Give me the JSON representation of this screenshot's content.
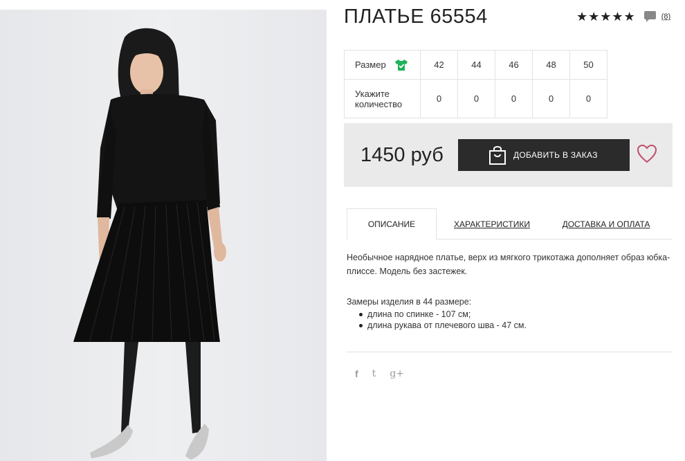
{
  "product": {
    "title": "ПЛАТЬЕ 65554",
    "stars": "★★★★★",
    "review_count": "(8)"
  },
  "size_table": {
    "size_label": "Размер",
    "qty_label_line1": "Укажите",
    "qty_label_line2": "количество",
    "sizes": [
      "42",
      "44",
      "46",
      "48",
      "50"
    ],
    "quantities": [
      "0",
      "0",
      "0",
      "0",
      "0"
    ]
  },
  "buy": {
    "price": "1450 руб",
    "add_label": "ДОБАВИТЬ В ЗАКАЗ"
  },
  "tabs": {
    "description": "ОПИСАНИЕ",
    "specs": "ХАРАКТЕРИСТИКИ",
    "delivery": "ДОСТАВКА И ОПЛАТА"
  },
  "description": {
    "text": "Необычное нарядное платье, верх из мягкого трикотажа дополняет образ юбка-плиссе. Модель без застежек.",
    "measure_title": "Замеры изделия в 44 размере:",
    "measures": [
      "длина по спинке - 107 см;",
      "длина рукава от плечевого шва - 47 см."
    ]
  },
  "social": {
    "facebook": "f",
    "twitter": "t",
    "gplus": "g+"
  },
  "colors": {
    "accent_button": "#2b2b2b",
    "heart": "#c0506a",
    "size_icon": "#1fb25a",
    "buybox_bg": "#eaeaea"
  }
}
